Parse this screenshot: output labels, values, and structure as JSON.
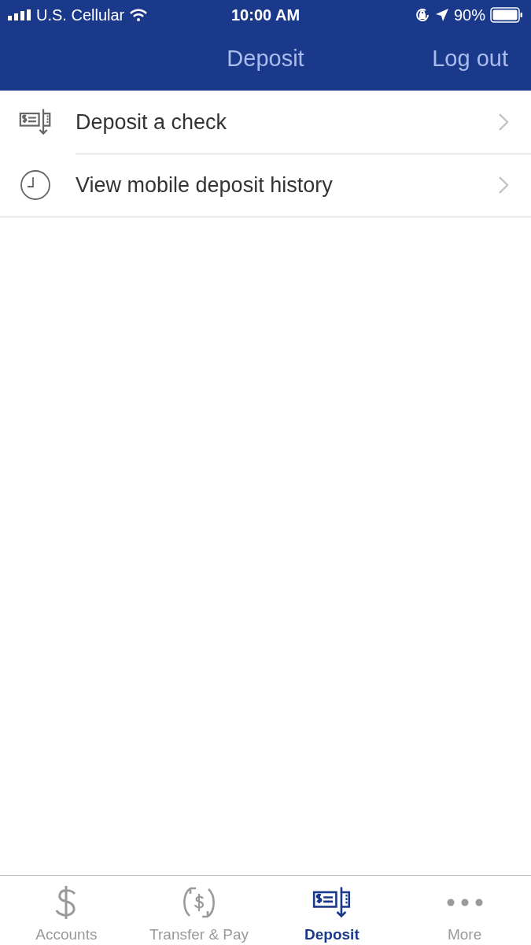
{
  "status_bar": {
    "carrier": "U.S. Cellular",
    "time": "10:00 AM",
    "battery": "90%"
  },
  "header": {
    "title": "Deposit",
    "action": "Log out"
  },
  "menu": [
    {
      "kind": "check",
      "label": "Deposit a check"
    },
    {
      "kind": "clock",
      "label": "View mobile deposit history"
    }
  ],
  "tabs": [
    {
      "kind": "dollar",
      "label": "Accounts",
      "selected": false
    },
    {
      "kind": "transfer",
      "label": "Transfer & Pay",
      "selected": false
    },
    {
      "kind": "check",
      "label": "Deposit",
      "selected": true
    },
    {
      "kind": "more",
      "label": "More",
      "selected": false
    }
  ]
}
